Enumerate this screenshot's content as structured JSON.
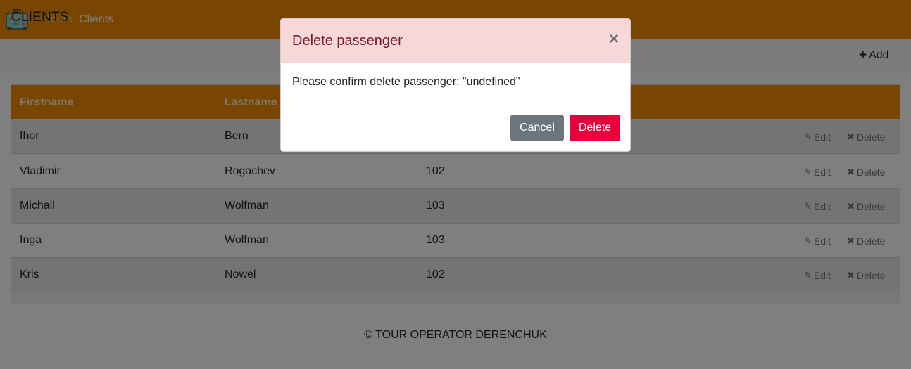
{
  "navbar": {
    "links": [
      {
        "label": "Tours"
      },
      {
        "label": "Clients"
      }
    ],
    "color": "#f08c00"
  },
  "page": {
    "title": "CLIENTS",
    "add_label": "Add"
  },
  "table": {
    "columns": [
      "Firstname",
      "Lastname",
      ""
    ],
    "rows": [
      {
        "firstname": "Ihor",
        "lastname": "Bern",
        "value": ""
      },
      {
        "firstname": "Vladimir",
        "lastname": "Rogachev",
        "value": "102"
      },
      {
        "firstname": "Michail",
        "lastname": "Wolfman",
        "value": "103"
      },
      {
        "firstname": "Inga",
        "lastname": "Wolfman",
        "value": "103"
      },
      {
        "firstname": "Kris",
        "lastname": "Nowel",
        "value": "102"
      }
    ],
    "edit_label": "Edit",
    "delete_label": "Delete"
  },
  "footer": {
    "text": "© TOUR OPERATOR DERENCHUK"
  },
  "modal": {
    "title": "Delete passenger",
    "close_symbol": "×",
    "body": "Please confirm delete passenger: \"undefined\"",
    "cancel_label": "Cancel",
    "delete_label": "Delete",
    "header_color": "#f8d7da",
    "danger_color": "#e8003d"
  }
}
